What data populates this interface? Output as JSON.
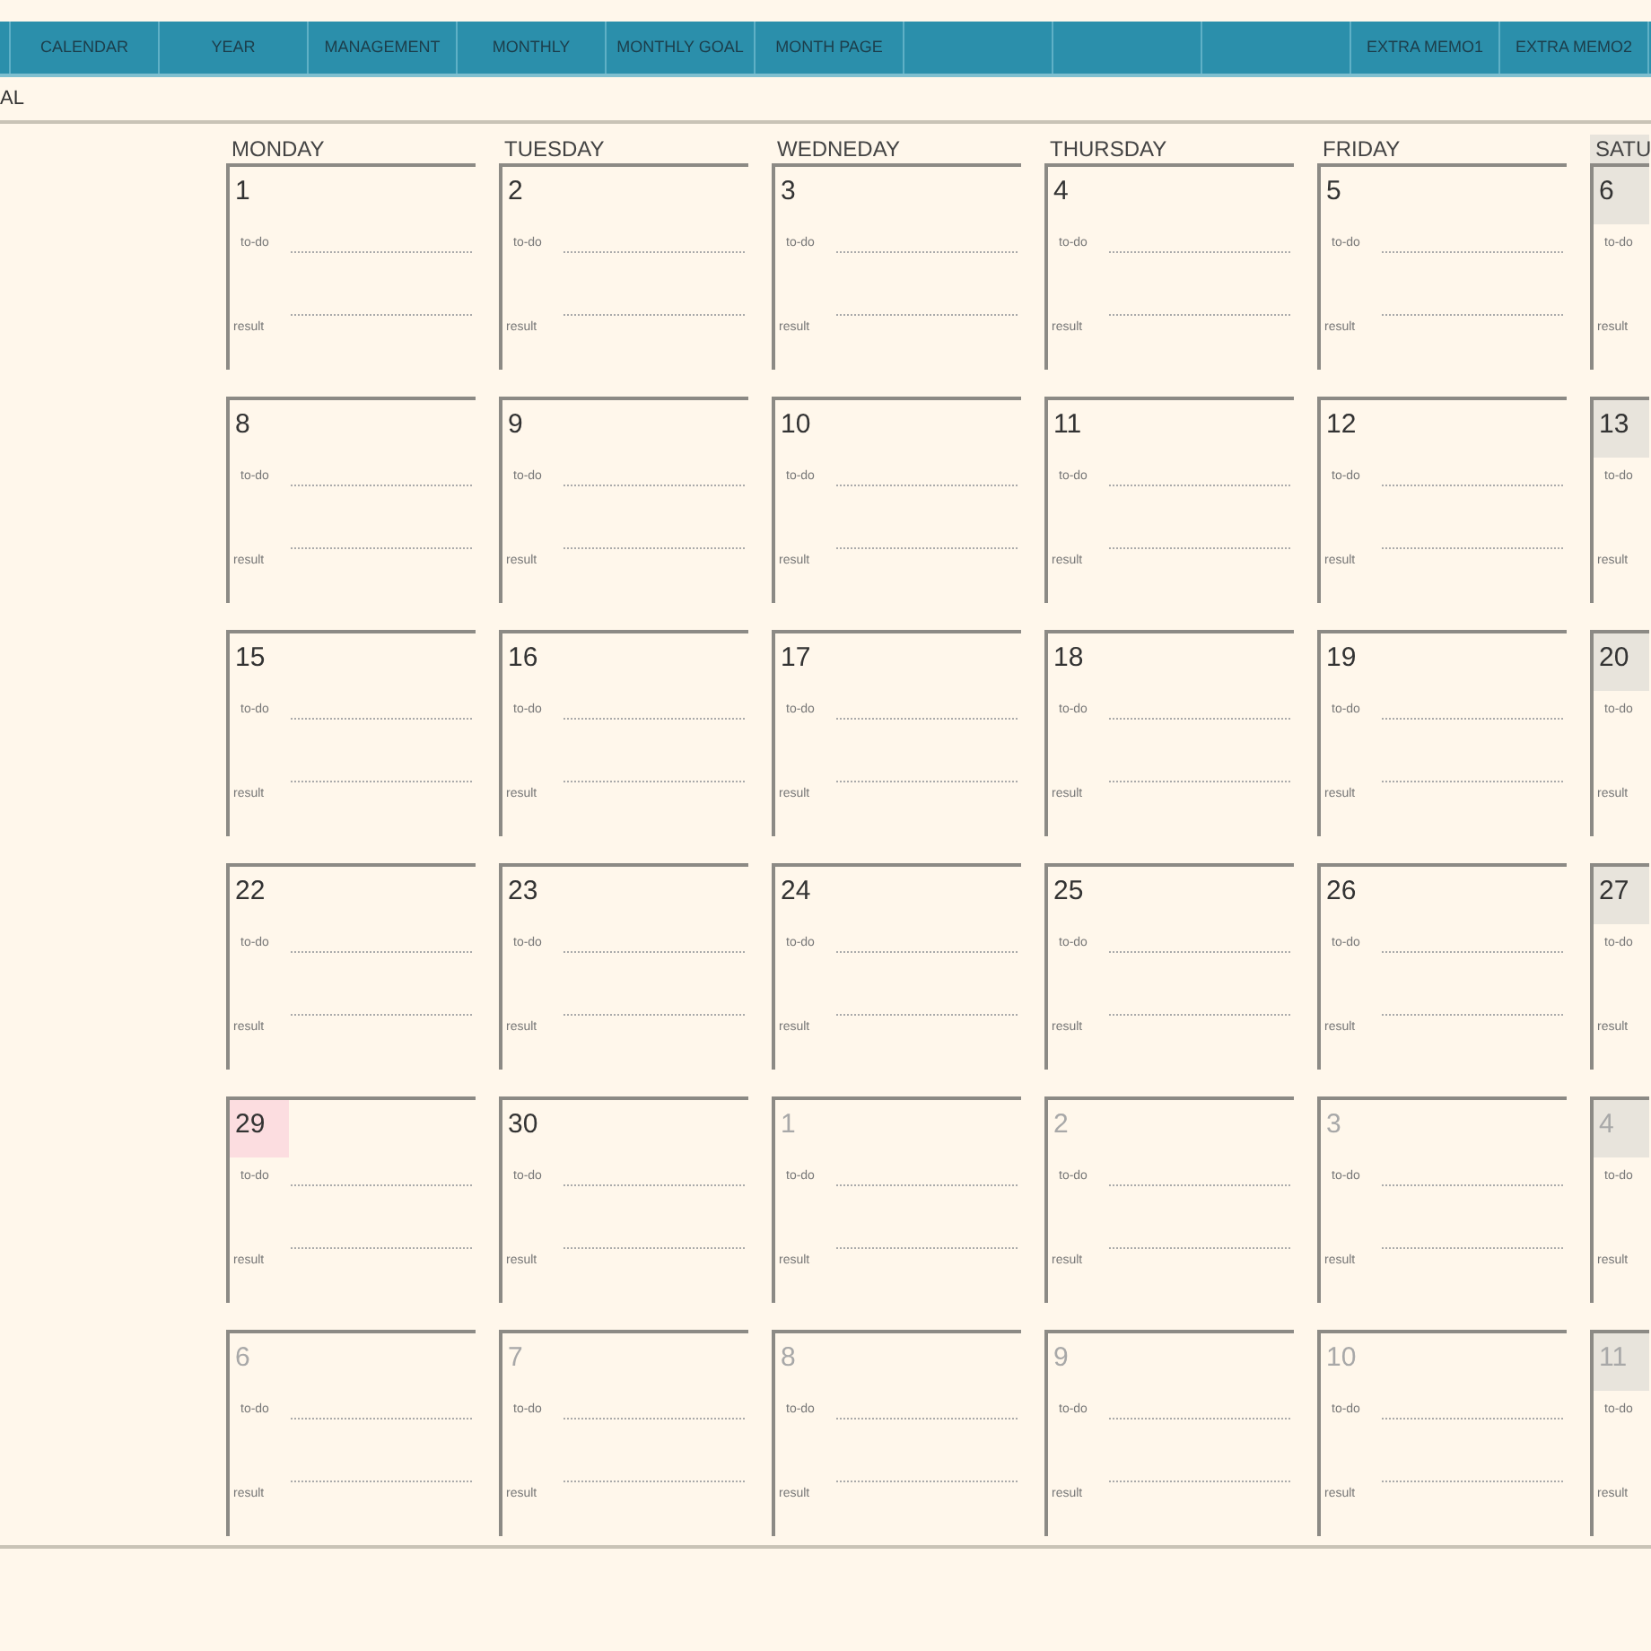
{
  "nav_tabs": [
    {
      "kind": "stub"
    },
    {
      "kind": "label",
      "label": "CALENDAR"
    },
    {
      "kind": "label",
      "label": "YEAR"
    },
    {
      "kind": "label",
      "label": "MANAGEMENT"
    },
    {
      "kind": "label",
      "label": "MONTHLY"
    },
    {
      "kind": "label",
      "label": "MONTHLY GOAL"
    },
    {
      "kind": "label",
      "label": "MONTH PAGE"
    },
    {
      "kind": "blank"
    },
    {
      "kind": "blank"
    },
    {
      "kind": "blank"
    },
    {
      "kind": "label",
      "label": "EXTRA MEMO1"
    },
    {
      "kind": "label",
      "label": "EXTRA MEMO2"
    }
  ],
  "subtitle": "AL",
  "columns": [
    {
      "label": "MONDAY",
      "weekend": false
    },
    {
      "label": "TUESDAY",
      "weekend": false
    },
    {
      "label": "WEDNEDAY",
      "weekend": false
    },
    {
      "label": "THURSDAY",
      "weekend": false
    },
    {
      "label": "FRIDAY",
      "weekend": false
    },
    {
      "label": "SATU",
      "weekend": true
    }
  ],
  "weeks": [
    {
      "cells": [
        {
          "date": "1",
          "in_month": true,
          "today": false,
          "todo": "to-do",
          "result": "result"
        },
        {
          "date": "2",
          "in_month": true,
          "today": false,
          "todo": "to-do",
          "result": "result"
        },
        {
          "date": "3",
          "in_month": true,
          "today": false,
          "todo": "to-do",
          "result": "result"
        },
        {
          "date": "4",
          "in_month": true,
          "today": false,
          "todo": "to-do",
          "result": "result"
        },
        {
          "date": "5",
          "in_month": true,
          "today": false,
          "todo": "to-do",
          "result": "result"
        },
        {
          "date": "6",
          "in_month": true,
          "today": false,
          "todo": "to-do",
          "result": "result"
        }
      ]
    },
    {
      "cells": [
        {
          "date": "8",
          "in_month": true,
          "today": false,
          "todo": "to-do",
          "result": "result"
        },
        {
          "date": "9",
          "in_month": true,
          "today": false,
          "todo": "to-do",
          "result": "result"
        },
        {
          "date": "10",
          "in_month": true,
          "today": false,
          "todo": "to-do",
          "result": "result"
        },
        {
          "date": "11",
          "in_month": true,
          "today": false,
          "todo": "to-do",
          "result": "result"
        },
        {
          "date": "12",
          "in_month": true,
          "today": false,
          "todo": "to-do",
          "result": "result"
        },
        {
          "date": "13",
          "in_month": true,
          "today": false,
          "todo": "to-do",
          "result": "result"
        }
      ]
    },
    {
      "cells": [
        {
          "date": "15",
          "in_month": true,
          "today": false,
          "todo": "to-do",
          "result": "result"
        },
        {
          "date": "16",
          "in_month": true,
          "today": false,
          "todo": "to-do",
          "result": "result"
        },
        {
          "date": "17",
          "in_month": true,
          "today": false,
          "todo": "to-do",
          "result": "result"
        },
        {
          "date": "18",
          "in_month": true,
          "today": false,
          "todo": "to-do",
          "result": "result"
        },
        {
          "date": "19",
          "in_month": true,
          "today": false,
          "todo": "to-do",
          "result": "result"
        },
        {
          "date": "20",
          "in_month": true,
          "today": false,
          "todo": "to-do",
          "result": "result"
        }
      ]
    },
    {
      "cells": [
        {
          "date": "22",
          "in_month": true,
          "today": false,
          "todo": "to-do",
          "result": "result"
        },
        {
          "date": "23",
          "in_month": true,
          "today": false,
          "todo": "to-do",
          "result": "result"
        },
        {
          "date": "24",
          "in_month": true,
          "today": false,
          "todo": "to-do",
          "result": "result"
        },
        {
          "date": "25",
          "in_month": true,
          "today": false,
          "todo": "to-do",
          "result": "result"
        },
        {
          "date": "26",
          "in_month": true,
          "today": false,
          "todo": "to-do",
          "result": "result"
        },
        {
          "date": "27",
          "in_month": true,
          "today": false,
          "todo": "to-do",
          "result": "result"
        }
      ]
    },
    {
      "cells": [
        {
          "date": "29",
          "in_month": true,
          "today": true,
          "todo": "to-do",
          "result": "result"
        },
        {
          "date": "30",
          "in_month": true,
          "today": false,
          "todo": "to-do",
          "result": "result"
        },
        {
          "date": "1",
          "in_month": false,
          "today": false,
          "todo": "to-do",
          "result": "result"
        },
        {
          "date": "2",
          "in_month": false,
          "today": false,
          "todo": "to-do",
          "result": "result"
        },
        {
          "date": "3",
          "in_month": false,
          "today": false,
          "todo": "to-do",
          "result": "result"
        },
        {
          "date": "4",
          "in_month": false,
          "today": false,
          "todo": "to-do",
          "result": "result"
        }
      ]
    },
    {
      "cells": [
        {
          "date": "6",
          "in_month": false,
          "today": false,
          "todo": "to-do",
          "result": "result"
        },
        {
          "date": "7",
          "in_month": false,
          "today": false,
          "todo": "to-do",
          "result": "result"
        },
        {
          "date": "8",
          "in_month": false,
          "today": false,
          "todo": "to-do",
          "result": "result"
        },
        {
          "date": "9",
          "in_month": false,
          "today": false,
          "todo": "to-do",
          "result": "result"
        },
        {
          "date": "10",
          "in_month": false,
          "today": false,
          "todo": "to-do",
          "result": "result"
        },
        {
          "date": "11",
          "in_month": false,
          "today": false,
          "todo": "to-do",
          "result": "result"
        }
      ]
    }
  ]
}
